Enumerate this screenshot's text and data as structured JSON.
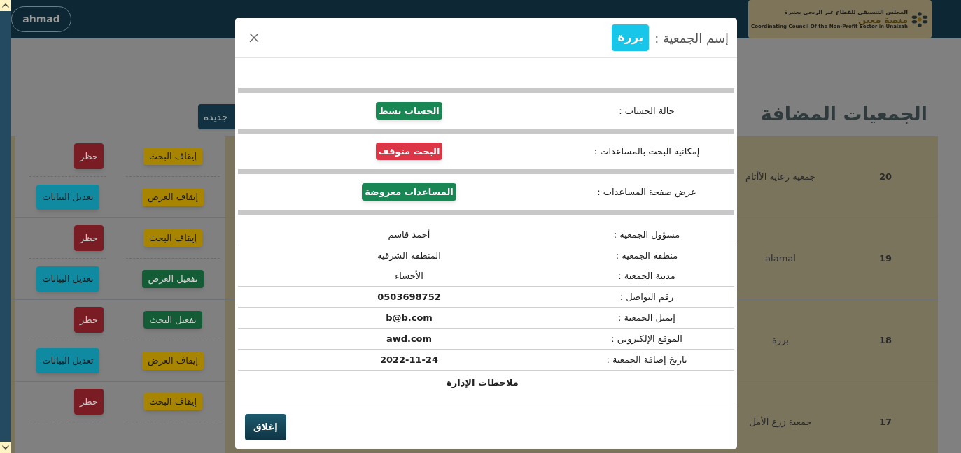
{
  "header": {
    "user_button": "ahmad",
    "logo": {
      "line_1": "المجلس التنسيقي للقطاع غير الربحي بعنيزة",
      "line_2": "منصة معين",
      "line_3": "Coordinating Council Of the Non-Profit Sector in Unaizah"
    }
  },
  "page": {
    "title": "الجمعيات المضافة",
    "add_button": "جديدة"
  },
  "table": {
    "rows": [
      {
        "number": "20",
        "name": "جمعية رعاية الأأتام",
        "search_action": {
          "label": "إيقاف البحث",
          "kind": "stop"
        },
        "display_action": {
          "label": "إيقاف العرض",
          "kind": "stop"
        },
        "block_button": "حظر",
        "edit_button": "تعديل البيانات"
      },
      {
        "number": "19",
        "name": "alamal",
        "search_action": {
          "label": "إيقاف البحث",
          "kind": "stop"
        },
        "display_action": {
          "label": "تفعيل العرض",
          "kind": "activate"
        },
        "block_button": "حظر",
        "edit_button": "تعديل البيانات"
      },
      {
        "number": "18",
        "name": "بررة",
        "search_action": {
          "label": "تفعيل البحث",
          "kind": "activate"
        },
        "display_action": {
          "label": "إيقاف العرض",
          "kind": "stop"
        },
        "block_button": "حظر",
        "edit_button": "تعديل البيانات"
      },
      {
        "number": "17",
        "name": "جمعية زرع الأمل",
        "search_action": {
          "label": "إيقاف البحث",
          "kind": "stop"
        },
        "block_button": "حظر"
      }
    ]
  },
  "modal": {
    "title": "إسم الجمعية :",
    "name_badge": "بررة",
    "status_rows": [
      {
        "label": "حالة الحساب :",
        "value": "الحساب نشط",
        "kind": "ok"
      },
      {
        "label": "إمكانية البحث بالمساعدات :",
        "value": "البحث متوقف",
        "kind": "stopped"
      },
      {
        "label": "عرض صفحة المساعدات :",
        "value": "المساعدات معروضة",
        "kind": "ok"
      }
    ],
    "info_groups": [
      [
        {
          "label": "مسؤول الجمعية :",
          "value": "أحمد قاسم",
          "emphasis": false
        }
      ],
      [
        {
          "label": "منطقة الجمعية :",
          "value": "المنطقة الشرقية",
          "emphasis": false
        },
        {
          "label": "مدينة الجمعية :",
          "value": "الأحساء",
          "emphasis": false
        }
      ],
      [
        {
          "label": "رقم التواصل :",
          "value": "0503698752",
          "emphasis": true
        }
      ],
      [
        {
          "label": "إيميل الجمعية :",
          "value": "b@b.com",
          "emphasis": true
        }
      ],
      [
        {
          "label": "الموقع الإلكتروني :",
          "value": "awd.com",
          "emphasis": true
        }
      ],
      [
        {
          "label": "تاريخ إضافة الجمعية :",
          "value": "2022-11-24",
          "emphasis": true
        }
      ]
    ],
    "notes_heading": "ملاحظات الإدارة",
    "close_button": "إغلاق"
  }
}
